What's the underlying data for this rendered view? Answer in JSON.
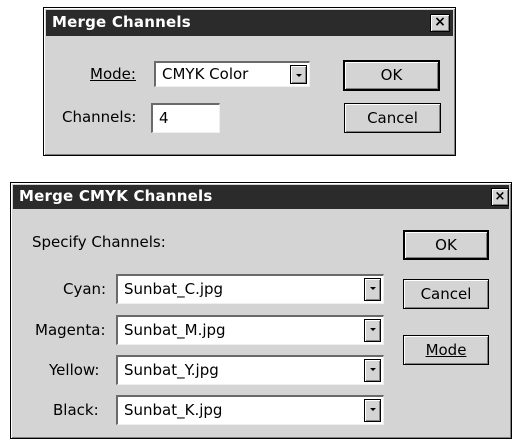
{
  "merge_channels": {
    "title": "Merge Channels",
    "close": "×",
    "mode_label": "Mode:",
    "mode_value": "CMYK Color",
    "channels_label": "Channels:",
    "channels_value": "4",
    "ok_label": "OK",
    "cancel_label": "Cancel"
  },
  "merge_cmyk": {
    "title": "Merge CMYK Channels",
    "close": "×",
    "specify_label": "Specify Channels:",
    "ok_label": "OK",
    "cancel_label": "Cancel",
    "mode_label": "Mode",
    "rows": [
      {
        "label": "Cyan:",
        "value": "Sunbat_C.jpg"
      },
      {
        "label": "Magenta:",
        "value": "Sunbat_M.jpg"
      },
      {
        "label": "Yellow:",
        "value": "Sunbat_Y.jpg"
      },
      {
        "label": "Black:",
        "value": "Sunbat_K.jpg"
      }
    ]
  }
}
